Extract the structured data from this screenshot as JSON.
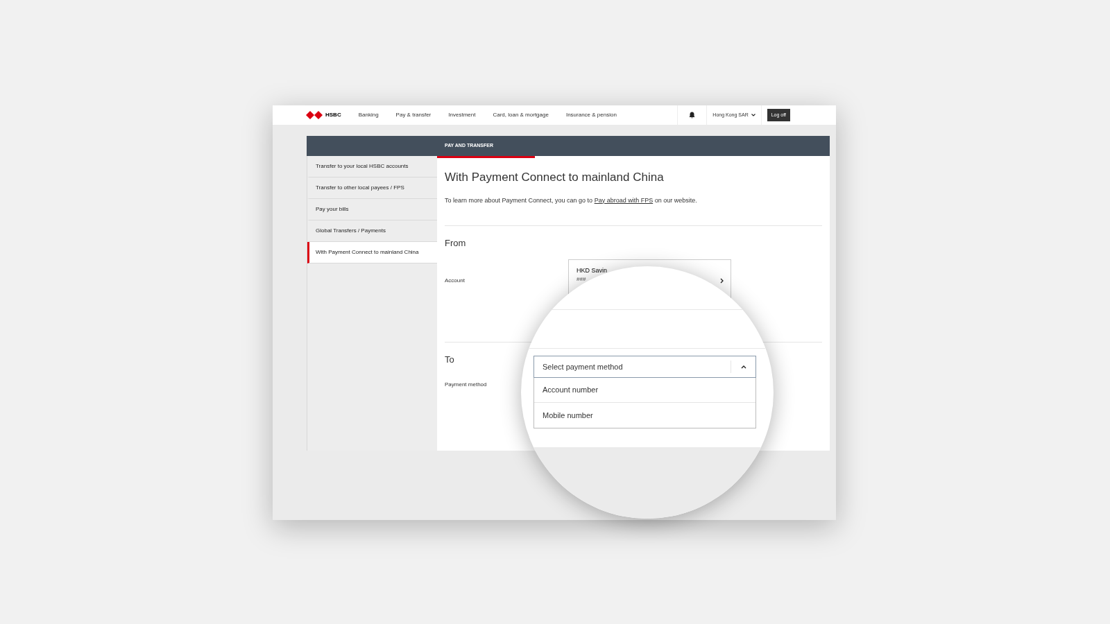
{
  "nav": {
    "logo": "HSBC",
    "items": [
      "Banking",
      "Pay & transfer",
      "Investment",
      "Card, loan & mortgage",
      "Insurance & pension"
    ],
    "region": "Hong Kong SAR",
    "logoff": "Log off"
  },
  "banner": {
    "title": "PAY AND TRANSFER"
  },
  "sidebar": {
    "items": [
      {
        "label": "Transfer to your local HSBC accounts",
        "selected": false
      },
      {
        "label": "Transfer to other local payees / FPS",
        "selected": false
      },
      {
        "label": "Pay your bills",
        "selected": false
      },
      {
        "label": "Global Transfers / Payments",
        "selected": false
      },
      {
        "label": "With Payment Connect to mainland China",
        "selected": true
      }
    ]
  },
  "main": {
    "title": "With Payment Connect to mainland China",
    "intro_before": "To learn more about Payment Connect, you can go to",
    "intro_link": "Pay abroad with FPS",
    "intro_after": "on our website.",
    "from": {
      "heading": "From",
      "account_label": "Account",
      "account_name": "HKD Savin",
      "account_number": "###"
    },
    "to": {
      "heading": "To",
      "payment_method_label": "Payment method"
    }
  },
  "magnifier": {
    "dropdown": {
      "placeholder": "Select payment method",
      "expanded": true,
      "options": [
        {
          "label": "Account number",
          "selected": false
        },
        {
          "label": "Mobile number",
          "selected": false
        }
      ]
    }
  }
}
